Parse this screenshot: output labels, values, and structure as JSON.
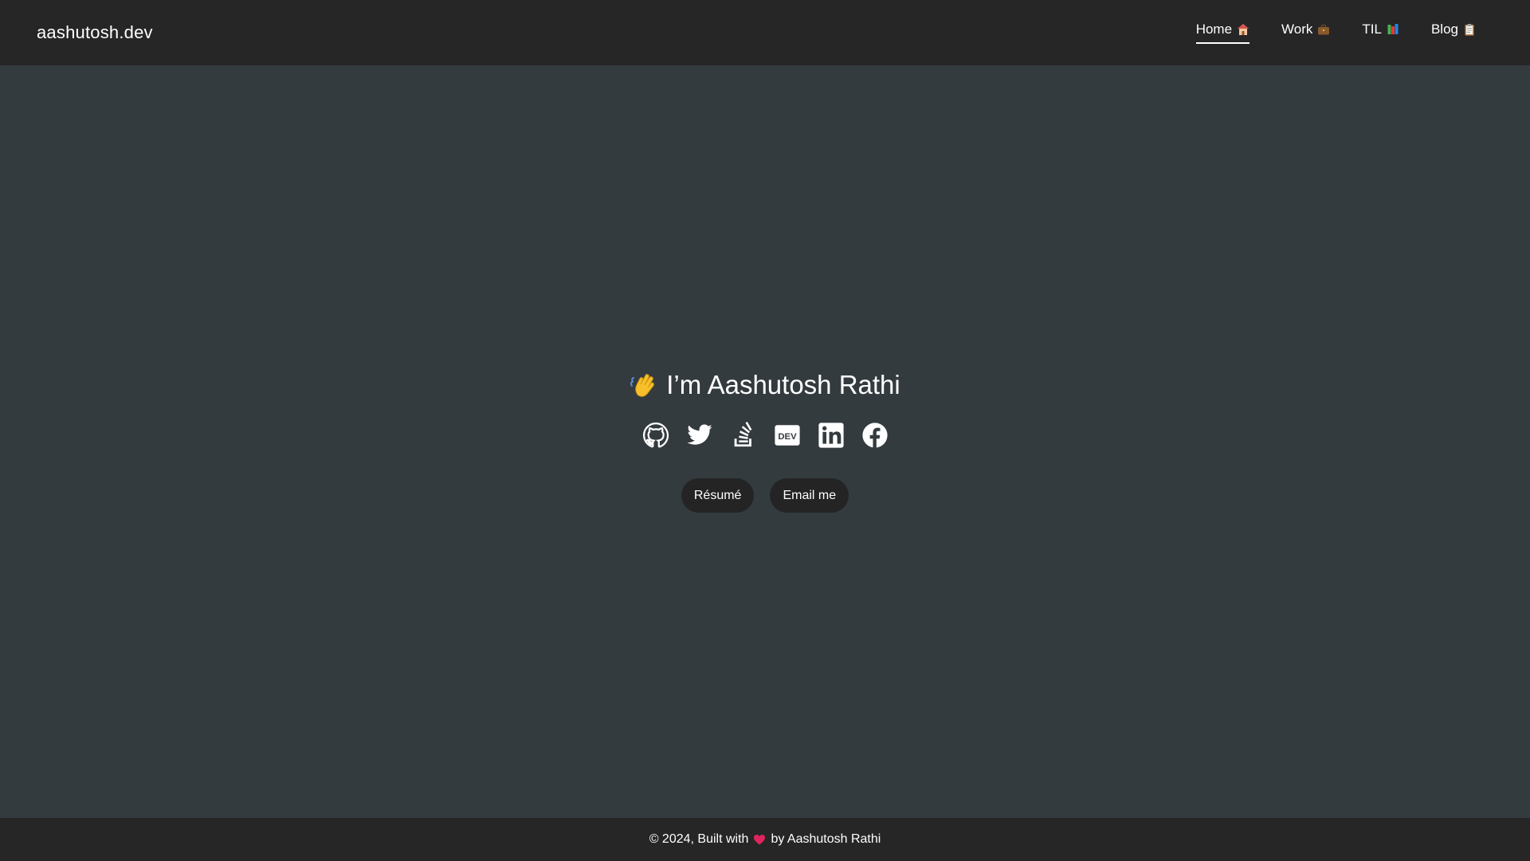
{
  "header": {
    "brand": "aashutosh.dev",
    "nav": [
      {
        "label": "Home",
        "icon": "house-icon",
        "active": true
      },
      {
        "label": "Work",
        "icon": "briefcase-icon",
        "active": false
      },
      {
        "label": "TIL",
        "icon": "books-icon",
        "active": false
      },
      {
        "label": "Blog",
        "icon": "clipboard-icon",
        "active": false
      }
    ]
  },
  "hero": {
    "title": "I’m Aashutosh Rathi",
    "title_icon": "waving-hand-icon"
  },
  "socials": [
    {
      "name": "github-icon"
    },
    {
      "name": "twitter-icon"
    },
    {
      "name": "stackoverflow-icon"
    },
    {
      "name": "dev-icon"
    },
    {
      "name": "linkedin-icon"
    },
    {
      "name": "facebook-icon"
    }
  ],
  "actions": {
    "resume_label": "Résumé",
    "email_label": "Email me"
  },
  "footer": {
    "prefix": "© 2024, Built with",
    "suffix": "by Aashutosh Rathi",
    "icon": "heart-icon"
  },
  "colors": {
    "background": "#343b3f",
    "header_footer": "#262626",
    "button": "#242424",
    "text": "#ffffff",
    "heart": "#e0245e"
  }
}
